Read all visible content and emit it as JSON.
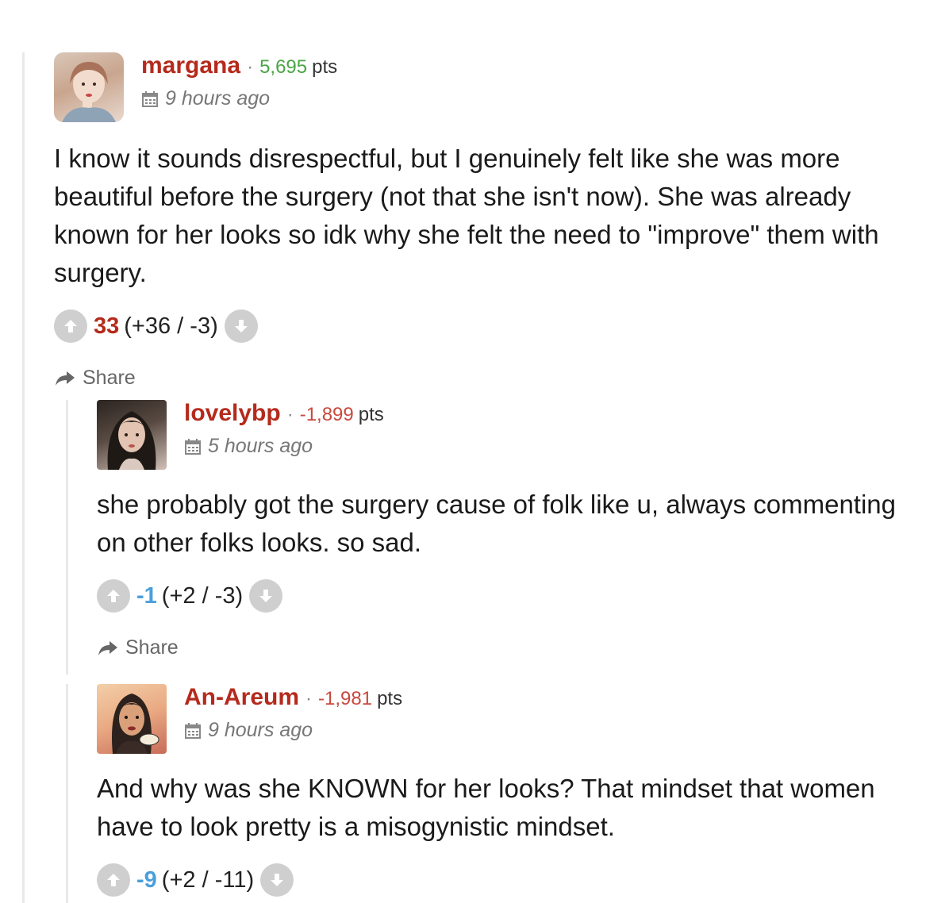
{
  "comments": [
    {
      "username": "margana",
      "points": "5,695",
      "points_label": "pts",
      "time": "9 hours ago",
      "text": "I know it sounds disrespectful, but I genuinely felt like she was more beautiful before the surgery (not that she isn't now). She was already known for her looks so idk why she felt the need to \"improve\" them with surgery.",
      "score": "33",
      "tally": "(+36 / -3)",
      "share_label": "Share"
    },
    {
      "username": "lovelybp",
      "points": "-1,899",
      "points_label": "pts",
      "time": "5 hours ago",
      "text": "she probably got the surgery cause of folk like u, always commenting on other folks looks. so sad.",
      "score": "-1",
      "tally": "(+2 / -3)",
      "share_label": "Share"
    },
    {
      "username": "An-Areum",
      "points": "-1,981",
      "points_label": "pts",
      "time": "9 hours ago",
      "text": "And why was she KNOWN for her looks? That mindset that women have to look pretty is a misogynistic mindset.",
      "score": "-9",
      "tally": "(+2 / -11)"
    }
  ],
  "icons": {
    "calendar": "calendar-icon",
    "upvote": "arrow-up-icon",
    "downvote": "arrow-down-icon",
    "share": "share-arrow-icon"
  },
  "colors": {
    "username": "#b52a1c",
    "points_positive": "#4aa545",
    "points_negative": "#c9483c",
    "score_positive": "#b52a1c",
    "score_negative": "#4a9fdc",
    "vote_button": "#cfcfcf"
  }
}
